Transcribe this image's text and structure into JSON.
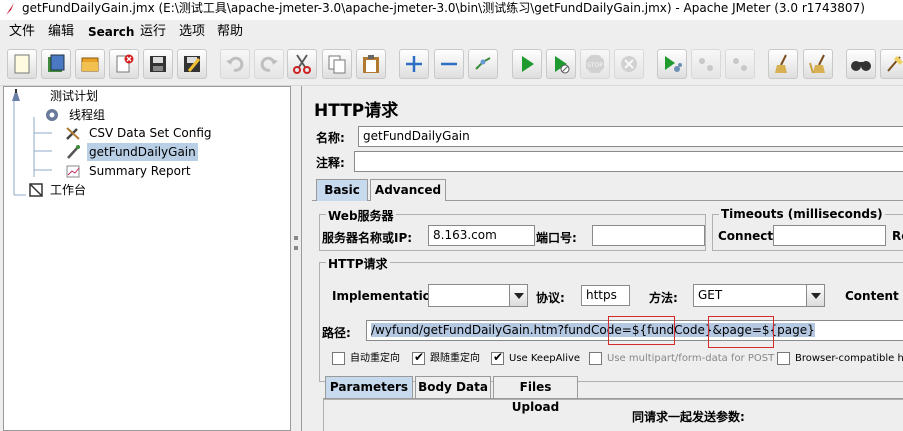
{
  "window": {
    "title": "getFundDailyGain.jmx (E:\\测试工具\\apache-jmeter-3.0\\apache-jmeter-3.0\\bin\\测试练习\\getFundDailyGain.jmx) - Apache JMeter (3.0 r1743807)"
  },
  "menu": [
    "文件",
    "编辑",
    "Search",
    "运行",
    "选项",
    "帮助"
  ],
  "toolbar": {
    "icons": [
      "new-icon",
      "templates-icon",
      "open-icon",
      "close-icon",
      "save-icon",
      "save-as-icon",
      "undo-icon",
      "redo-icon",
      "cut-icon",
      "copy-icon",
      "paste-icon",
      "expand-icon",
      "collapse-icon",
      "toggle-icon",
      "start-icon",
      "start-no-pause-icon",
      "stop-icon",
      "shutdown-icon",
      "remote-start-icon",
      "remote-stop-icon",
      "remote-shutdown-icon",
      "clear-icon",
      "clear-all-icon",
      "search-icon",
      "reset-search-icon"
    ]
  },
  "tree": {
    "test_plan": "测试计划",
    "thread_group": "线程组",
    "csv_config": "CSV Data Set Config",
    "http_sampler": "getFundDailyGain",
    "summary_report": "Summary Report",
    "workbench": "工作台"
  },
  "panel": {
    "title": "HTTP请求",
    "name_label": "名称:",
    "name_value": "getFundDailyGain",
    "comment_label": "注释:",
    "comment_value": "",
    "tabs": [
      "Basic",
      "Advanced"
    ],
    "web_server": {
      "group_title": "Web服务器",
      "server_label": "服务器名称或IP:",
      "server_value": "8.163.com",
      "port_label": "端口号:",
      "port_value": ""
    },
    "timeouts": {
      "group_title": "Timeouts (milliseconds)",
      "connect_label": "Connect:",
      "connect_value": "",
      "response_label": "Re"
    },
    "http_request": {
      "group_title": "HTTP请求",
      "implementation_label": "Implementation:",
      "implementation_value": "",
      "protocol_label": "协议:",
      "protocol_value": "https",
      "method_label": "方法:",
      "method_value": "GET",
      "content_encoding_label": "Content er",
      "path_label": "路径:",
      "path_part1": "/wyfund/getFundDailyGain.htm?fundCode=",
      "path_var1": "${fundCode}",
      "path_part2": "&page=",
      "path_var2": "${page}"
    },
    "checkboxes": [
      {
        "label": "自动重定向",
        "checked": false,
        "enabled": true
      },
      {
        "label": "跟随重定向",
        "checked": true,
        "enabled": true
      },
      {
        "label": "Use KeepAlive",
        "checked": true,
        "enabled": true
      },
      {
        "label": "Use multipart/form-data for POST",
        "checked": false,
        "enabled": false
      },
      {
        "label": "Browser-compatible he",
        "checked": false,
        "enabled": true
      }
    ],
    "sub_tabs": [
      "Parameters",
      "Body Data",
      "Files Upload"
    ],
    "params_header": "同请求一起发送参数:"
  },
  "colors": {
    "selection": "#b8cfe5",
    "active_tab": "#c7d9ec",
    "path_highlight": "#b5c8e2",
    "annotation_red": "#d32b2b"
  }
}
